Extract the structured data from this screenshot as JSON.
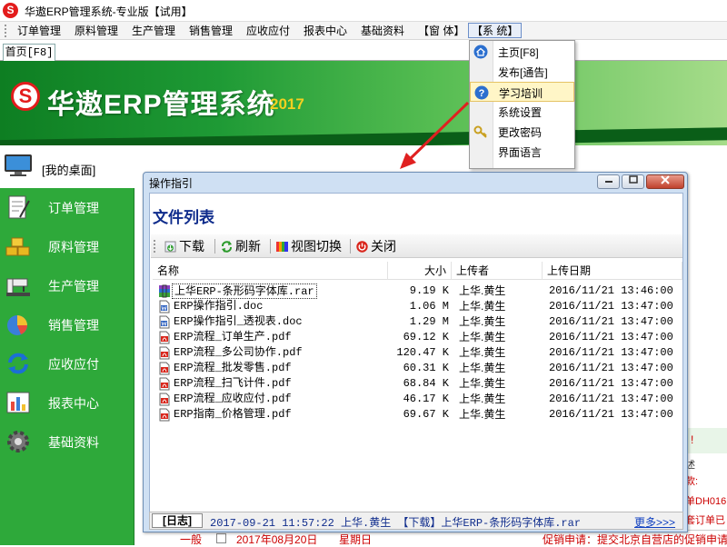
{
  "window": {
    "title": "华遨ERP管理系统-专业版【试用】",
    "logo_letter": "S"
  },
  "menubar": {
    "items": [
      "订单管理",
      "原料管理",
      "生产管理",
      "销售管理",
      "应收应付",
      "报表中心",
      "基础资料",
      "【窗 体】",
      "【系 统】"
    ]
  },
  "system_menu": {
    "items": [
      "主页[F8]",
      "发布[通告]",
      "学习培训",
      "系统设置",
      "更改密码",
      "界面语言"
    ],
    "highlighted": "学习培训"
  },
  "tabs": {
    "home": "首页[F8]"
  },
  "banner": {
    "title": "华遨ERP管理系统",
    "year": "2017"
  },
  "sidebar": {
    "desktop": "[我的桌面]",
    "items": [
      "订单管理",
      "原料管理",
      "生产管理",
      "销售管理",
      "应收应付",
      "报表中心",
      "基础资料"
    ]
  },
  "dialog": {
    "title": "操作指引",
    "heading": "文件列表",
    "toolbar": {
      "download": "下载",
      "refresh": "刷新",
      "switch_view": "视图切换",
      "close": "关闭"
    },
    "columns": {
      "name": "名称",
      "size": "大小",
      "uploader": "上传者",
      "date": "上传日期"
    },
    "files": [
      {
        "name": "上华ERP-条形码字体库.rar",
        "size": "9.19 K",
        "uploader": "上华.黄生",
        "date": "2016/11/21 13:46:00",
        "type": "rar"
      },
      {
        "name": "ERP操作指引.doc",
        "size": "1.06 M",
        "uploader": "上华.黄生",
        "date": "2016/11/21 13:47:00",
        "type": "doc"
      },
      {
        "name": "ERP操作指引_透视表.doc",
        "size": "1.29 M",
        "uploader": "上华.黄生",
        "date": "2016/11/21 13:47:00",
        "type": "doc"
      },
      {
        "name": "ERP流程_订单生产.pdf",
        "size": "69.12 K",
        "uploader": "上华.黄生",
        "date": "2016/11/21 13:47:00",
        "type": "pdf"
      },
      {
        "name": "ERP流程_多公司协作.pdf",
        "size": "120.47 K",
        "uploader": "上华.黄生",
        "date": "2016/11/21 13:47:00",
        "type": "pdf"
      },
      {
        "name": "ERP流程_批发零售.pdf",
        "size": "60.31 K",
        "uploader": "上华.黄生",
        "date": "2016/11/21 13:47:00",
        "type": "pdf"
      },
      {
        "name": "ERP流程_扫飞计件.pdf",
        "size": "68.84 K",
        "uploader": "上华.黄生",
        "date": "2016/11/21 13:47:00",
        "type": "pdf"
      },
      {
        "name": "ERP流程_应收应付.pdf",
        "size": "46.17 K",
        "uploader": "上华.黄生",
        "date": "2016/11/21 13:47:00",
        "type": "pdf"
      },
      {
        "name": "ERP指南_价格管理.pdf",
        "size": "69.67 K",
        "uploader": "上华.黄生",
        "date": "2016/11/21 13:47:00",
        "type": "pdf"
      }
    ],
    "status": {
      "log_label": "[日志]",
      "text": "2017-09-21 11:57:22 上华.黄生 【下载】上华ERP-条形码字体库.rar",
      "more": "更多>>>"
    }
  },
  "background": {
    "notes": [
      "!",
      "述",
      "款:",
      "单DH016",
      "套订单已"
    ],
    "bottom_row": {
      "level": "一般",
      "date": "2017年08月20日",
      "weekday": "星期日",
      "message": "促销申请：提交北京自营店的促销申请（商"
    }
  },
  "colors": {
    "sidebar": "#2ea93a",
    "accent": "#0f2c8c",
    "logo": "#e31c1c"
  }
}
